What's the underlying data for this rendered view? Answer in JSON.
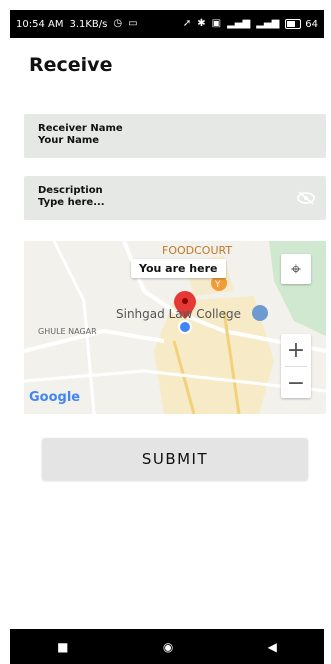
{
  "status_bar": {
    "time": "10:54 AM",
    "speed": "3.1KB/s",
    "battery_text": "64",
    "battery_level": 0.64
  },
  "page": {
    "title": "Receive"
  },
  "receiver": {
    "label": "Receiver Name",
    "placeholder": "Your Name"
  },
  "description": {
    "label": "Description",
    "placeholder": "Type here..."
  },
  "map": {
    "poi_foodcourt": "FOODCOURT",
    "popup": "You are here",
    "place_college": "Sinhgad Law College",
    "area_label": "GHULE NAGAR",
    "attribution": "Google"
  },
  "submit": {
    "label": "SUBMIT"
  },
  "colors": {
    "field_bg": "#e6e8e6",
    "pin_red": "#e53935",
    "dot_blue": "#4285f4",
    "green_area": "#cfe8cf"
  }
}
